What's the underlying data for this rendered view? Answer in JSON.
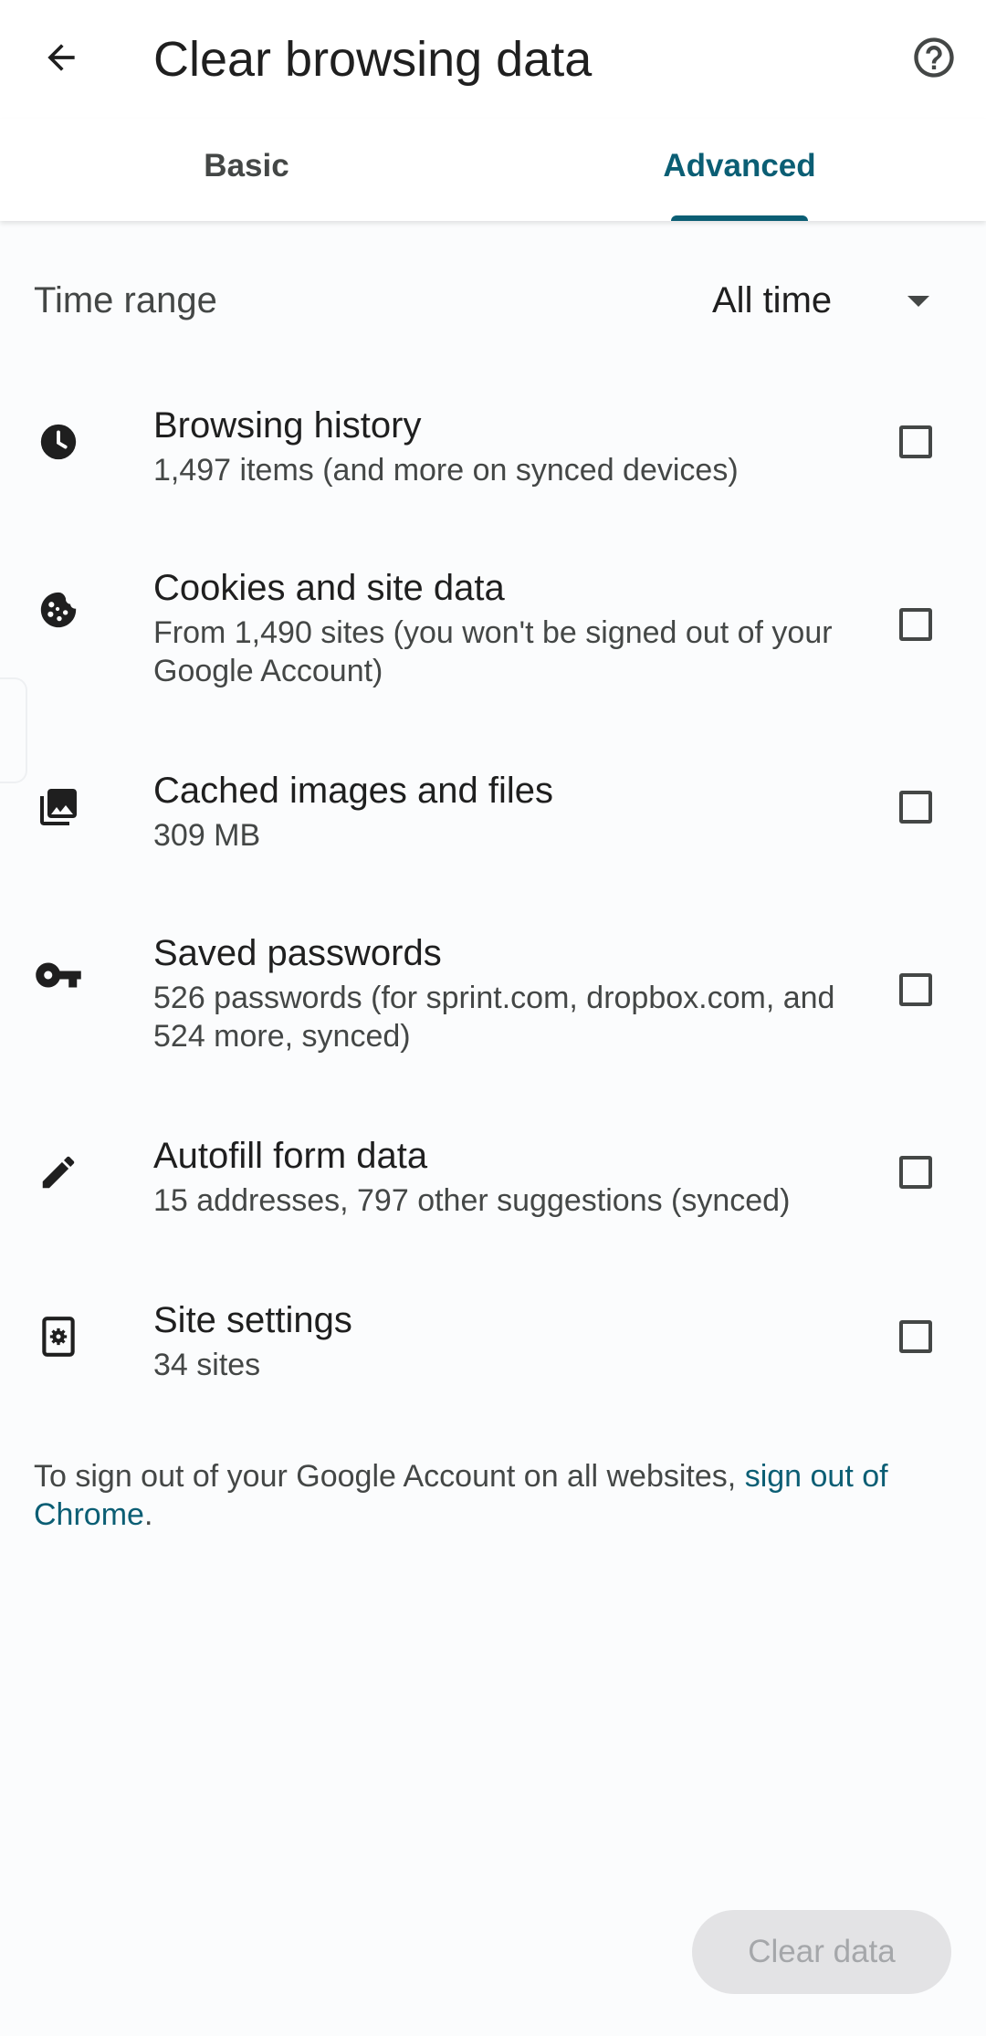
{
  "header": {
    "title": "Clear browsing data",
    "back_icon": "arrow-back-icon",
    "help_icon": "help-circle-icon"
  },
  "tabs": [
    {
      "label": "Basic",
      "selected": false
    },
    {
      "label": "Advanced",
      "selected": true
    }
  ],
  "time_range": {
    "label": "Time range",
    "value": "All time"
  },
  "options": [
    {
      "icon": "clock-icon",
      "title": "Browsing history",
      "subtitle": "1,497 items (and more on synced devices)",
      "checked": false
    },
    {
      "icon": "cookie-icon",
      "title": "Cookies and site data",
      "subtitle": "From 1,490 sites (you won't be signed out of your Google Account)",
      "checked": false
    },
    {
      "icon": "image-icon",
      "title": "Cached images and files",
      "subtitle": "309 MB",
      "checked": false
    },
    {
      "icon": "key-icon",
      "title": "Saved passwords",
      "subtitle": "526 passwords (for sprint.com, dropbox.com, and 524 more, synced)",
      "checked": false
    },
    {
      "icon": "pencil-icon",
      "title": "Autofill form data",
      "subtitle": "15 addresses, 797 other suggestions (synced)",
      "checked": false
    },
    {
      "icon": "site-settings-icon",
      "title": "Site settings",
      "subtitle": "34 sites",
      "checked": false
    }
  ],
  "footer": {
    "text_before": "To sign out of your Google Account on all websites, ",
    "link": "sign out of Chrome",
    "text_after": "."
  },
  "actions": {
    "clear_label": "Clear data",
    "clear_enabled": false
  },
  "colors": {
    "accent": "#0b5e74",
    "text_primary": "#1f1f1f",
    "text_secondary": "#444746",
    "disabled_bg": "#e3e3e5",
    "disabled_text": "#a5a7aa"
  }
}
